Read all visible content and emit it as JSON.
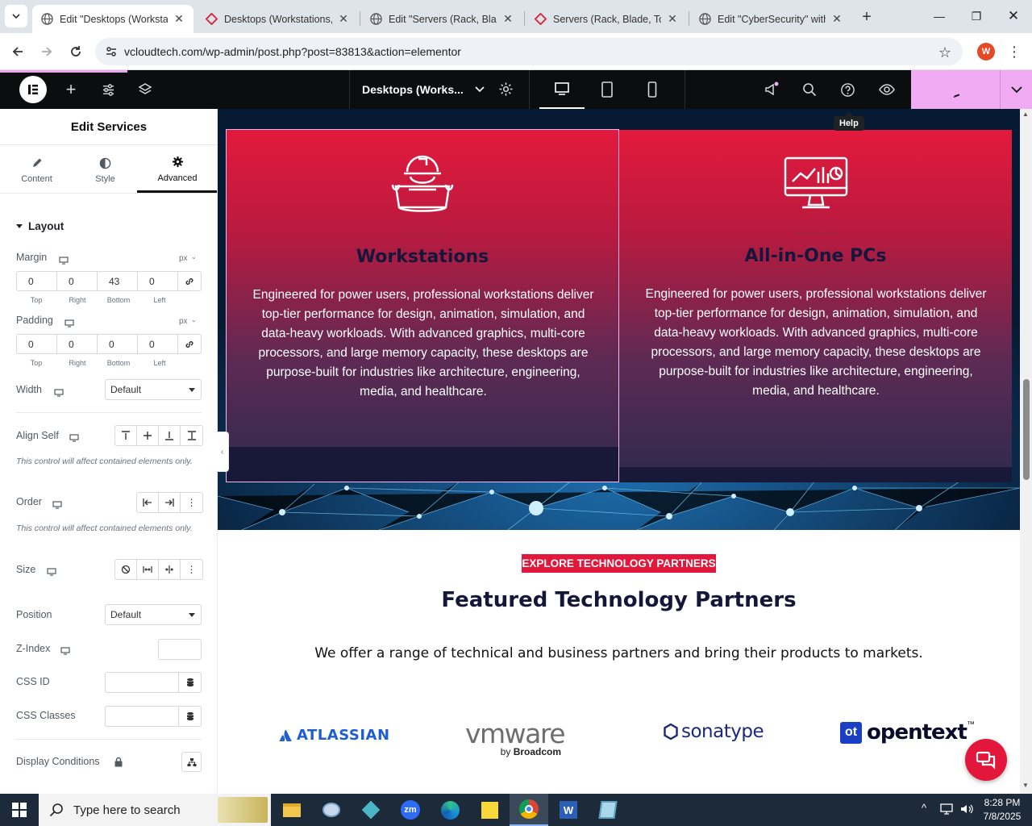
{
  "browser": {
    "tabs": [
      {
        "title": "Edit \"Desktops (Workstat",
        "active": true
      },
      {
        "title": "Desktops (Workstations, ",
        "active": false
      },
      {
        "title": "Edit \"Servers (Rack, Blade",
        "active": false
      },
      {
        "title": "Servers (Rack, Blade, Tow",
        "active": false
      },
      {
        "title": "Edit \"CyberSecurity\" with",
        "active": false
      }
    ],
    "url": "vcloudtech.com/wp-admin/post.php?post=83813&action=elementor",
    "profile_initial": "W"
  },
  "elementor_bar": {
    "document_title": "Desktops (Works...",
    "help_tooltip": "Help"
  },
  "panel": {
    "title": "Edit Services",
    "tabs": [
      "Content",
      "Style",
      "Advanced"
    ],
    "active_tab": "Advanced",
    "section": "Layout",
    "margin": {
      "label": "Margin",
      "unit": "px",
      "top": "0",
      "right": "0",
      "bottom": "43",
      "left": "0"
    },
    "padding": {
      "label": "Padding",
      "unit": "px",
      "top": "0",
      "right": "0",
      "bottom": "0",
      "left": "0"
    },
    "dim_labels": [
      "Top",
      "Right",
      "Bottom",
      "Left"
    ],
    "width": {
      "label": "Width",
      "value": "Default"
    },
    "align_self": {
      "label": "Align Self",
      "note": "This control will affect contained elements only."
    },
    "order": {
      "label": "Order",
      "note": "This control will affect contained elements only."
    },
    "size": {
      "label": "Size"
    },
    "position": {
      "label": "Position",
      "value": "Default"
    },
    "z_index": {
      "label": "Z-Index"
    },
    "css_id": {
      "label": "CSS ID"
    },
    "css_classes": {
      "label": "CSS Classes"
    },
    "display_conditions": {
      "label": "Display Conditions"
    }
  },
  "page": {
    "cards": [
      {
        "title": "Workstations",
        "icon": "technician-icon",
        "body": "Engineered for power users, professional workstations deliver top-tier performance for design, animation, simulation, and data-heavy workloads. With advanced graphics, multi-core processors, and large memory capacity, these desktops are purpose-built for industries like architecture, engineering, media, and healthcare."
      },
      {
        "title": "All-in-One PCs",
        "icon": "monitor-analytics-icon",
        "body": "Engineered for power users, professional workstations deliver top-tier performance for design, animation, simulation, and data-heavy workloads. With advanced graphics, multi-core processors, and large memory capacity, these desktops are purpose-built for industries like architecture, engineering, media, and healthcare."
      }
    ],
    "badge": "EXPLORE TECHNOLOGY PARTNERS",
    "heading": "Featured Technology Partners",
    "subheading": "We offer a range of technical and business partners and bring their products to markets.",
    "partners": {
      "atlassian": "ATLASSIAN",
      "vmware": "vmware",
      "vmware_by": "by",
      "vmware_broadcom": "Broadcom",
      "sonatype": "sonatype",
      "opentext_mark": "ot",
      "opentext": "opentext",
      "opentext_tm": "™"
    }
  },
  "taskbar": {
    "search_placeholder": "Type here to search",
    "time": "8:28 PM",
    "date": "7/8/2025"
  },
  "colors": {
    "accent_red": "#e3173b",
    "elementor_pink": "#f0abf3",
    "navy": "#14173a"
  }
}
